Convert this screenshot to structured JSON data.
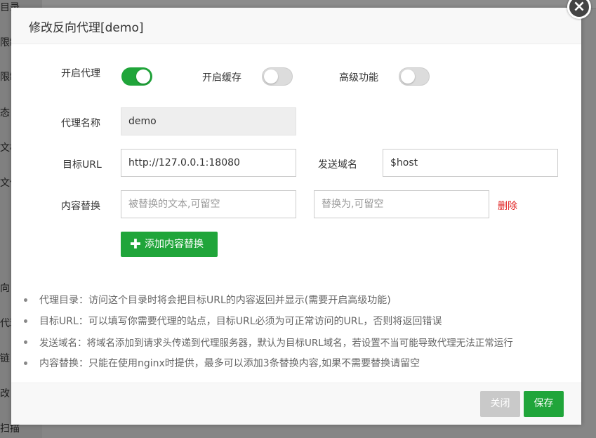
{
  "background": {
    "sidebar_items": [
      "目录",
      "限制",
      "限制",
      "态",
      "文档",
      "文件",
      "向",
      "代理",
      "链",
      "改",
      "扫描"
    ]
  },
  "dialog": {
    "title": "修改反向代理[demo]",
    "close_symbol": "×",
    "toggles": [
      {
        "label": "开启代理",
        "on": true
      },
      {
        "label": "开启缓存",
        "on": false
      },
      {
        "label": "高级功能",
        "on": false
      }
    ],
    "proxy_name": {
      "label": "代理名称",
      "value": "demo"
    },
    "target_url": {
      "label": "目标URL",
      "value": "http://127.0.0.1:18080"
    },
    "send_domain": {
      "label": "发送域名",
      "value": "$host"
    },
    "content_replace": {
      "label": "内容替换",
      "from_placeholder": "被替换的文本,可留空",
      "to_placeholder": "替换为,可留空",
      "delete_label": "删除"
    },
    "add_button": {
      "icon": "plus-icon",
      "label": "添加内容替换"
    },
    "tips": [
      "代理目录：访问这个目录时将会把目标URL的内容返回并显示(需要开启高级功能)",
      "目标URL：可以填写你需要代理的站点，目标URL必须为可正常访问的URL，否则将返回错误",
      "发送域名：将域名添加到请求头传递到代理服务器，默认为目标URL域名，若设置不当可能导致代理无法正常运行",
      "内容替换：只能在使用nginx时提供，最多可以添加3条替换内容,如果不需要替换请留空"
    ],
    "footer": {
      "close_label": "关闭",
      "save_label": "保存"
    }
  },
  "colors": {
    "accent": "#20a53a",
    "danger": "#e02020",
    "disabled": "#c9c9c9"
  }
}
